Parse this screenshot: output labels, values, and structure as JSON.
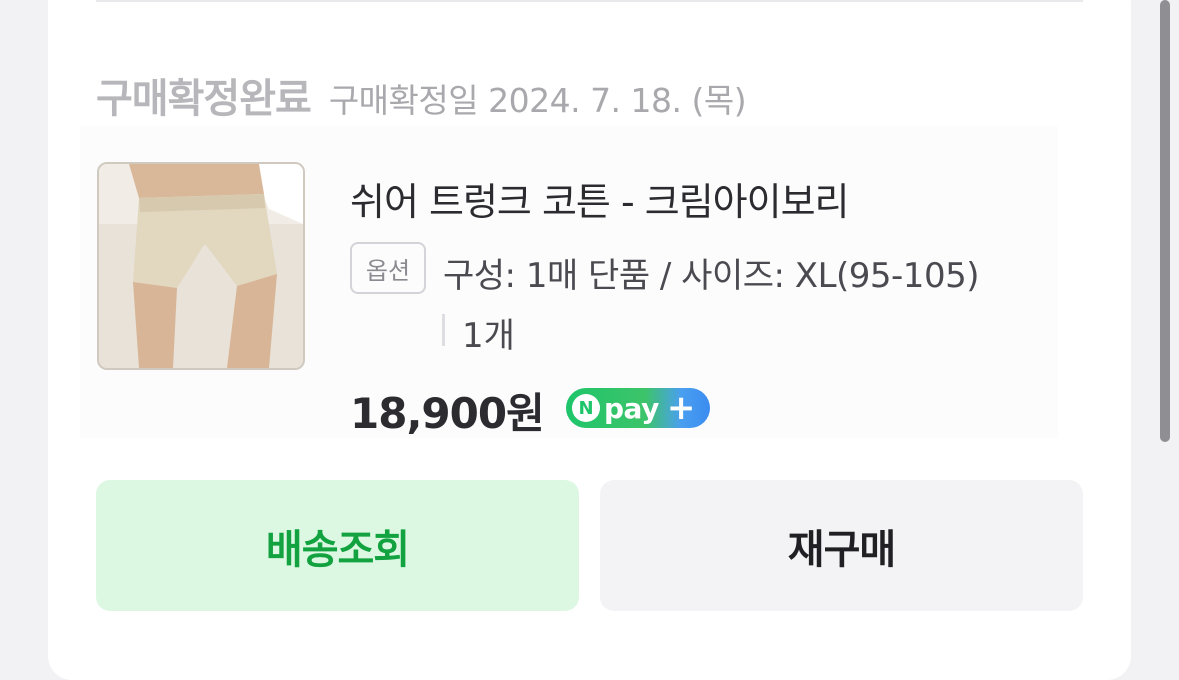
{
  "order": {
    "status_title": "구매확정완료",
    "status_date": "구매확정일 2024. 7. 18. (목)"
  },
  "product": {
    "name": "쉬어 트렁크 코튼 - 크림아이보리",
    "option_badge": "옵션",
    "option_text": "구성: 1매 단품 / 사이즈: XL(95-105)",
    "quantity": "1개",
    "price": "18,900원",
    "npay": {
      "n_letter": "N",
      "label": "pay",
      "plus": "+"
    }
  },
  "buttons": {
    "track_label": "배송조회",
    "rebuy_label": "재구매"
  },
  "colors": {
    "accent_green": "#12a23f",
    "track_bg": "#dcf8e3",
    "rebuy_bg": "#f3f3f5"
  }
}
